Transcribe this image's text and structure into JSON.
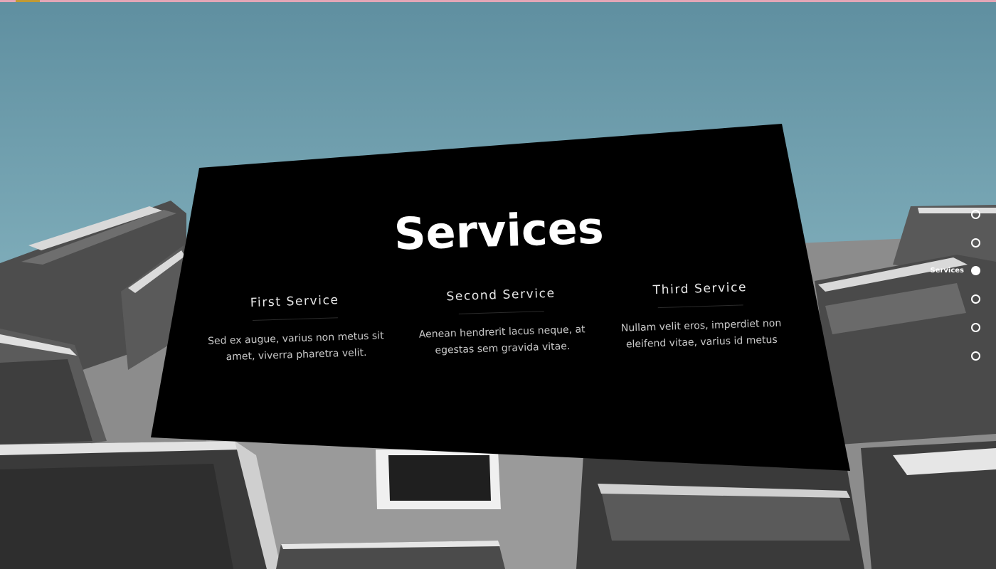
{
  "colors": {
    "sky_top": "#5f8fa0",
    "sky_bottom": "#9fcbd4",
    "card": "#000000",
    "top_strip": "#e3a6b6",
    "logo": "#c29a33",
    "text_primary": "#ffffff",
    "text_secondary": "#c9c9c9"
  },
  "section": {
    "title": "Services"
  },
  "services": [
    {
      "title": "First Service",
      "description": "Sed ex augue, varius non metus sit amet, viverra pharetra velit."
    },
    {
      "title": "Second Service",
      "description": "Aenean hendrerit lacus neque, at egestas sem gravida vitae."
    },
    {
      "title": "Third Service",
      "description": "Nullam velit eros, imperdiet non eleifend vitae, varius id metus"
    }
  ],
  "dot_nav": {
    "items": [
      {
        "label": "",
        "active": false
      },
      {
        "label": "",
        "active": false
      },
      {
        "label": "Services",
        "active": true
      },
      {
        "label": "",
        "active": false
      },
      {
        "label": "",
        "active": false
      },
      {
        "label": "",
        "active": false
      }
    ]
  },
  "icons": {
    "logo": "logo-icon",
    "nav_dot": "circle-icon"
  }
}
